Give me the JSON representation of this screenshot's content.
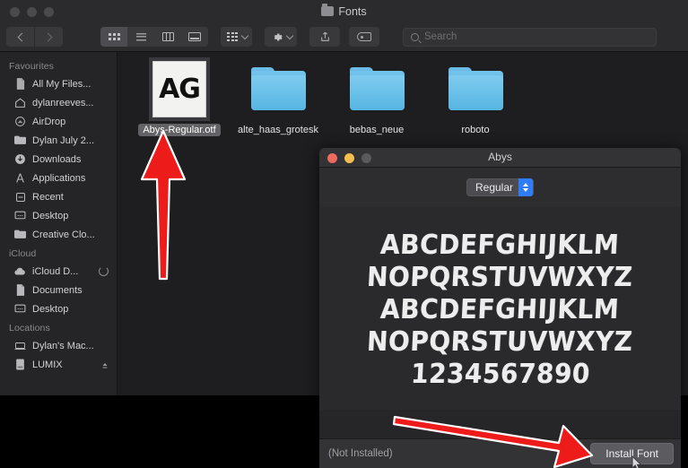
{
  "finder": {
    "title": "Fonts",
    "title_icon": "folder-icon",
    "traffic_lights": [
      "close-button",
      "minimize-button",
      "zoom-button"
    ],
    "toolbar": {
      "back_label": "",
      "forward_label": "",
      "view_modes": [
        {
          "name": "icon-view",
          "icon": "grid-icon",
          "active": true
        },
        {
          "name": "list-view",
          "icon": "list-icon",
          "active": false
        },
        {
          "name": "column-view",
          "icon": "columns-icon",
          "active": false
        },
        {
          "name": "gallery-view",
          "icon": "gallery-icon",
          "active": false
        }
      ],
      "arrange_icon": "grid-arrange-icon",
      "action_icon": "gear-icon",
      "share_icon": "share-icon",
      "tag_icon": "tag-icon"
    },
    "search": {
      "placeholder": "Search",
      "value": "",
      "icon": "search-icon"
    },
    "sidebar": {
      "sections": [
        {
          "header": "Favourites",
          "items": [
            {
              "label": "All My Files...",
              "icon": "document-icon"
            },
            {
              "label": "dylanreeves...",
              "icon": "home-icon"
            },
            {
              "label": "AirDrop",
              "icon": "airdrop-icon"
            },
            {
              "label": "Dylan July 2...",
              "icon": "folder-icon"
            },
            {
              "label": "Downloads",
              "icon": "download-icon"
            },
            {
              "label": "Applications",
              "icon": "applications-icon"
            },
            {
              "label": "Recent",
              "icon": "recent-icon"
            },
            {
              "label": "Desktop",
              "icon": "desktop-icon"
            },
            {
              "label": "Creative Clo...",
              "icon": "folder-icon"
            }
          ]
        },
        {
          "header": "iCloud",
          "items": [
            {
              "label": "iCloud D...",
              "icon": "icloud-icon",
              "accessory": "sync-spinner"
            },
            {
              "label": "Documents",
              "icon": "documents-icon"
            },
            {
              "label": "Desktop",
              "icon": "desktop-icon"
            }
          ]
        },
        {
          "header": "Locations",
          "items": [
            {
              "label": "Dylan's Mac...",
              "icon": "laptop-icon"
            },
            {
              "label": "LUMIX",
              "icon": "drive-icon",
              "accessory": "eject-icon"
            }
          ]
        }
      ]
    },
    "files": [
      {
        "name": "Abys-Regular.otf",
        "type": "font-file",
        "glyphs": "AG",
        "selected": true
      },
      {
        "name": "alte_haas_grotesk",
        "type": "folder",
        "selected": false
      },
      {
        "name": "bebas_neue",
        "type": "folder",
        "selected": false
      },
      {
        "name": "roboto",
        "type": "folder",
        "selected": false
      }
    ]
  },
  "fontbook": {
    "title": "Abys",
    "traffic_lights": [
      "close-button",
      "minimize-button",
      "zoom-button"
    ],
    "style_popup": {
      "value": "Regular",
      "options": [
        "Regular"
      ]
    },
    "preview_lines": [
      "ABCDEFGHIJKLM",
      "NOPQRSTUVWXYZ",
      "ABCDEFGHIJKLM",
      "NOPQRSTUVWXYZ",
      "1234567890"
    ],
    "status": "(Not Installed)",
    "install_button": "Install Font"
  },
  "annotations": {
    "arrow_up": {
      "name": "arrow-pointing-to-font-file",
      "color": "#ee1b1b"
    },
    "arrow_diagonal": {
      "name": "arrow-pointing-to-install-button",
      "color": "#ee1b1b"
    }
  },
  "colors": {
    "accent_blue": "#2f7cf6",
    "folder_blue": "#6bbde8",
    "arrow_red": "#ee1b1b",
    "window_bg": "#1e1e20"
  }
}
